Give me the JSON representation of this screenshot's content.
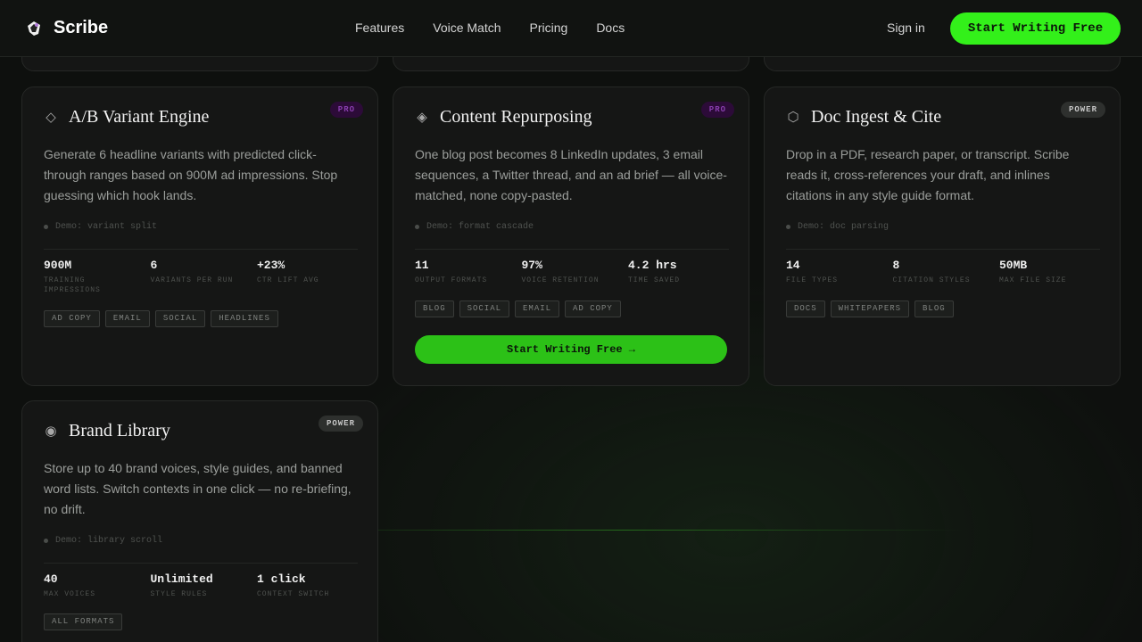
{
  "nav": {
    "brand": "Scribe",
    "links": [
      "Features",
      "Voice Match",
      "Pricing",
      "Docs"
    ],
    "signin": "Sign in",
    "cta": "Start Writing Free"
  },
  "cards": [
    {
      "icon": "diamond-outline-icon",
      "title": "A/B Variant Engine",
      "badge": "PRO",
      "description": "Generate 6 headline variants with predicted click-through ranges based on 900M ad impressions. Stop guessing which hook lands.",
      "demo": "Demo: variant split",
      "stats": [
        {
          "value": "900M",
          "label": "TRAINING IMPRESSIONS"
        },
        {
          "value": "6",
          "label": "VARIANTS PER RUN"
        },
        {
          "value": "+23%",
          "label": "CTR LIFT AVG"
        }
      ],
      "tags": [
        "AD COPY",
        "EMAIL",
        "SOCIAL",
        "HEADLINES"
      ]
    },
    {
      "icon": "diamond-filled-icon",
      "title": "Content Repurposing",
      "badge": "PRO",
      "description": "One blog post becomes 8 LinkedIn updates, 3 email sequences, a Twitter thread, and an ad brief — all voice-matched, none copy-pasted.",
      "demo": "Demo: format cascade",
      "stats": [
        {
          "value": "11",
          "label": "OUTPUT FORMATS"
        },
        {
          "value": "97%",
          "label": "VOICE RETENTION"
        },
        {
          "value": "4.2 hrs",
          "label": "TIME SAVED"
        }
      ],
      "tags": [
        "BLOG",
        "SOCIAL",
        "EMAIL",
        "AD COPY"
      ],
      "cta": "Start Writing Free →"
    },
    {
      "icon": "hexagon-icon",
      "title": "Doc Ingest & Cite",
      "badge": "POWER",
      "description": "Drop in a PDF, research paper, or transcript. Scribe reads it, cross-references your draft, and inlines citations in any style guide format.",
      "demo": "Demo: doc parsing",
      "stats": [
        {
          "value": "14",
          "label": "FILE TYPES"
        },
        {
          "value": "8",
          "label": "CITATION STYLES"
        },
        {
          "value": "50MB",
          "label": "MAX FILE SIZE"
        }
      ],
      "tags": [
        "DOCS",
        "WHITEPAPERS",
        "BLOG"
      ]
    },
    {
      "icon": "circle-dot-icon",
      "title": "Brand Library",
      "badge": "POWER",
      "description": "Store up to 40 brand voices, style guides, and banned word lists. Switch contexts in one click — no re-briefing, no drift.",
      "demo": "Demo: library scroll",
      "stats": [
        {
          "value": "40",
          "label": "MAX VOICES"
        },
        {
          "value": "Unlimited",
          "label": "STYLE RULES"
        },
        {
          "value": "1 click",
          "label": "CONTEXT SWITCH"
        }
      ],
      "tags": [
        "ALL FORMATS"
      ]
    }
  ]
}
